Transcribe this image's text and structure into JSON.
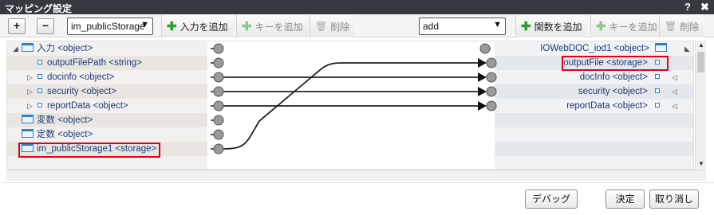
{
  "window": {
    "title": "マッピング設定",
    "help_label": "?",
    "close_label": "✖"
  },
  "toolbar": {
    "expand_label": "+",
    "collapse_label": "−",
    "source_select": "im_publicStorage",
    "add_input_label": "入力を追加",
    "add_key_label": "キーを追加",
    "delete_label": "削除",
    "function_select": "add",
    "add_function_label": "関数を追加",
    "add_key_label_right": "キーを追加",
    "delete_label_right": "削除"
  },
  "left_tree": [
    {
      "label": "入力 <object>",
      "kind": "object",
      "expanded": true
    },
    {
      "label": "outputFilePath <string>",
      "kind": "property"
    },
    {
      "label": "docinfo <object>",
      "kind": "property",
      "collapsed": true
    },
    {
      "label": "security <object>",
      "kind": "property",
      "collapsed": true
    },
    {
      "label": "reportData <object>",
      "kind": "property",
      "collapsed": true
    },
    {
      "label": "変数 <object>",
      "kind": "object"
    },
    {
      "label": "定数 <object>",
      "kind": "object"
    },
    {
      "label": "im_publicStorage1 <storage>",
      "kind": "object",
      "highlighted": true
    }
  ],
  "right_tree": [
    {
      "label": "IOWebDOC_iod1 <object>",
      "kind": "object",
      "expanded": true
    },
    {
      "label": "outputFile <storage>",
      "kind": "property",
      "highlighted": true
    },
    {
      "label": "docInfo <object>",
      "kind": "property",
      "collapsed": true
    },
    {
      "label": "security <object>",
      "kind": "property",
      "collapsed": true
    },
    {
      "label": "reportData <object>",
      "kind": "property",
      "collapsed": true
    }
  ],
  "mappings": [
    {
      "from": "im_publicStorage1 <storage>",
      "to": "outputFile <storage>"
    },
    {
      "from": "docinfo <object>",
      "to": "docInfo <object>"
    },
    {
      "from": "security <object>",
      "to": "security <object>"
    },
    {
      "from": "reportData <object>",
      "to": "reportData <object>"
    }
  ],
  "footer": {
    "debug_label": "デバッグ",
    "ok_label": "決定",
    "cancel_label": "取り消し"
  },
  "colors": {
    "titlebar": "#343a40",
    "highlight": "#e0001b",
    "node_text": "#1e3a78",
    "add_icon": "#2e9e2e"
  }
}
